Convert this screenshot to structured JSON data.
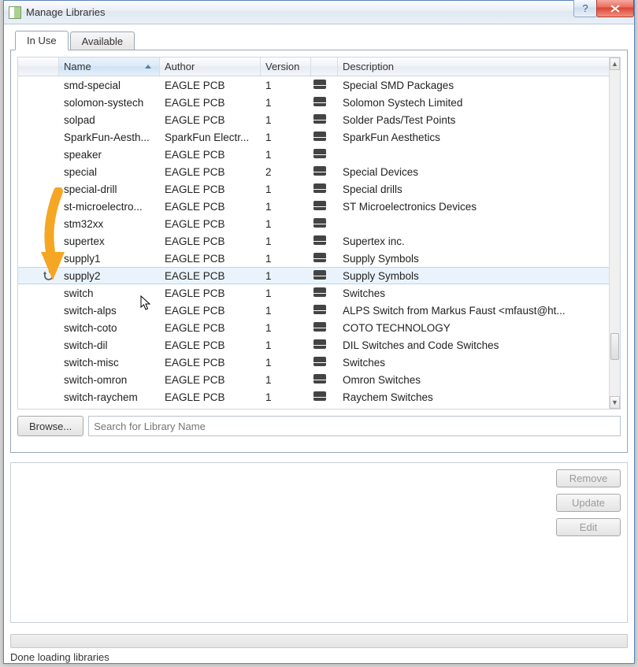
{
  "window": {
    "title": "Manage Libraries"
  },
  "tabs": {
    "in_use": "In Use",
    "available": "Available",
    "active": "in_use"
  },
  "table": {
    "columns": {
      "name": "Name",
      "author": "Author",
      "version": "Version",
      "description": "Description"
    },
    "sorted_by": "name",
    "rows": [
      {
        "name": "smd-special",
        "author": "EAGLE PCB",
        "version": "1",
        "description": "Special SMD Packages"
      },
      {
        "name": "solomon-systech",
        "author": "EAGLE PCB",
        "version": "1",
        "description": "Solomon Systech Limited"
      },
      {
        "name": "solpad",
        "author": "EAGLE PCB",
        "version": "1",
        "description": "Solder Pads/Test Points"
      },
      {
        "name": "SparkFun-Aesth...",
        "author": "SparkFun Electr...",
        "version": "1",
        "description": "SparkFun Aesthetics"
      },
      {
        "name": "speaker",
        "author": "EAGLE PCB",
        "version": "1",
        "description": ""
      },
      {
        "name": "special",
        "author": "EAGLE PCB",
        "version": "2",
        "description": "Special Devices"
      },
      {
        "name": "special-drill",
        "author": "EAGLE PCB",
        "version": "1",
        "description": "Special drills"
      },
      {
        "name": "st-microelectro...",
        "author": "EAGLE PCB",
        "version": "1",
        "description": "ST Microelectronics Devices"
      },
      {
        "name": "stm32xx",
        "author": "EAGLE PCB",
        "version": "1",
        "description": ""
      },
      {
        "name": "supertex",
        "author": "EAGLE PCB",
        "version": "1",
        "description": "Supertex inc."
      },
      {
        "name": "supply1",
        "author": "EAGLE PCB",
        "version": "1",
        "description": "Supply Symbols"
      },
      {
        "name": "supply2",
        "author": "EAGLE PCB",
        "version": "1",
        "description": "Supply Symbols",
        "selected": true,
        "update_icon": true
      },
      {
        "name": "switch",
        "author": "EAGLE PCB",
        "version": "1",
        "description": "Switches"
      },
      {
        "name": "switch-alps",
        "author": "EAGLE PCB",
        "version": "1",
        "description": "ALPS Switch from Markus Faust <mfaust@ht..."
      },
      {
        "name": "switch-coto",
        "author": "EAGLE PCB",
        "version": "1",
        "description": "COTO TECHNOLOGY"
      },
      {
        "name": "switch-dil",
        "author": "EAGLE PCB",
        "version": "1",
        "description": "DIL Switches and Code Switches"
      },
      {
        "name": "switch-misc",
        "author": "EAGLE PCB",
        "version": "1",
        "description": "Switches"
      },
      {
        "name": "switch-omron",
        "author": "EAGLE PCB",
        "version": "1",
        "description": "Omron Switches"
      },
      {
        "name": "switch-raychem",
        "author": "EAGLE PCB",
        "version": "1",
        "description": "Raychem Switches"
      }
    ]
  },
  "browse": {
    "button": "Browse...",
    "placeholder": "Search for Library Name"
  },
  "side_buttons": {
    "remove": "Remove",
    "update": "Update",
    "edit": "Edit"
  },
  "status": "Done loading libraries",
  "annotation_color": "#f5a623"
}
